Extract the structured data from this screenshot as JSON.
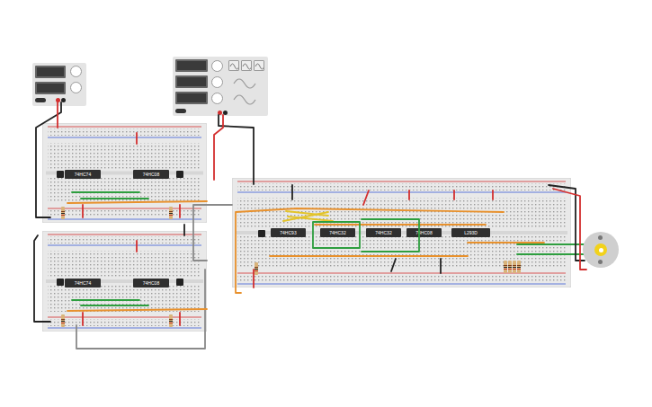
{
  "breadboards": [
    {
      "chips": [
        {
          "label": "74HC74"
        },
        {
          "label": "74HC08"
        }
      ]
    },
    {
      "chips": [
        {
          "label": "74HC74"
        },
        {
          "label": "74HC08"
        }
      ]
    },
    {
      "chips": [
        {
          "label": "74HC93"
        },
        {
          "label": "74HC32"
        },
        {
          "label": "74HC32"
        },
        {
          "label": "74HC08"
        },
        {
          "label": "L293D"
        }
      ]
    }
  ]
}
